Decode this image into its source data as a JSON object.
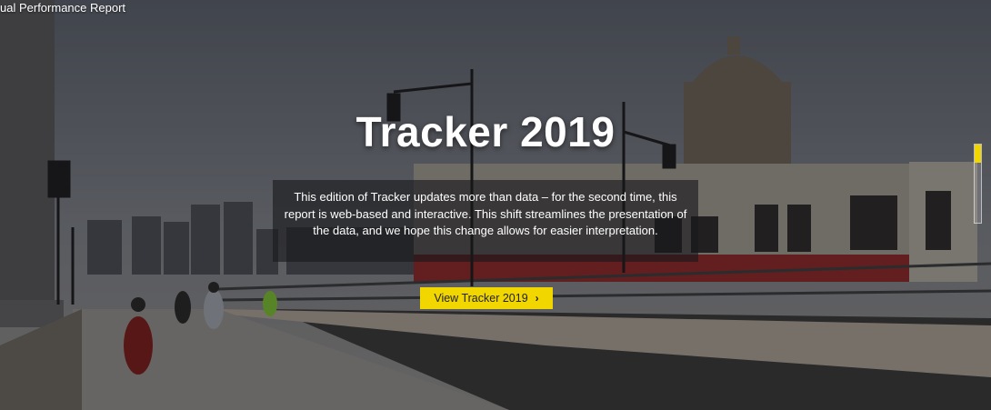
{
  "header": {
    "report_label": "ual Performance Report"
  },
  "hero": {
    "title": "Tracker 2019",
    "description": "This edition of Tracker updates more than data – for the second time, this report is web-based and interactive. This shift streamlines the presentation of the data, and we hope this change allows for easier interpretation.",
    "cta_label": "View Tracker 2019",
    "cta_icon": "chevron-right-icon",
    "background_image": "bridge-with-train-photo"
  },
  "slider": {
    "progress": 0.23
  },
  "colors": {
    "accent": "#f2d600",
    "text": "#ffffff"
  }
}
